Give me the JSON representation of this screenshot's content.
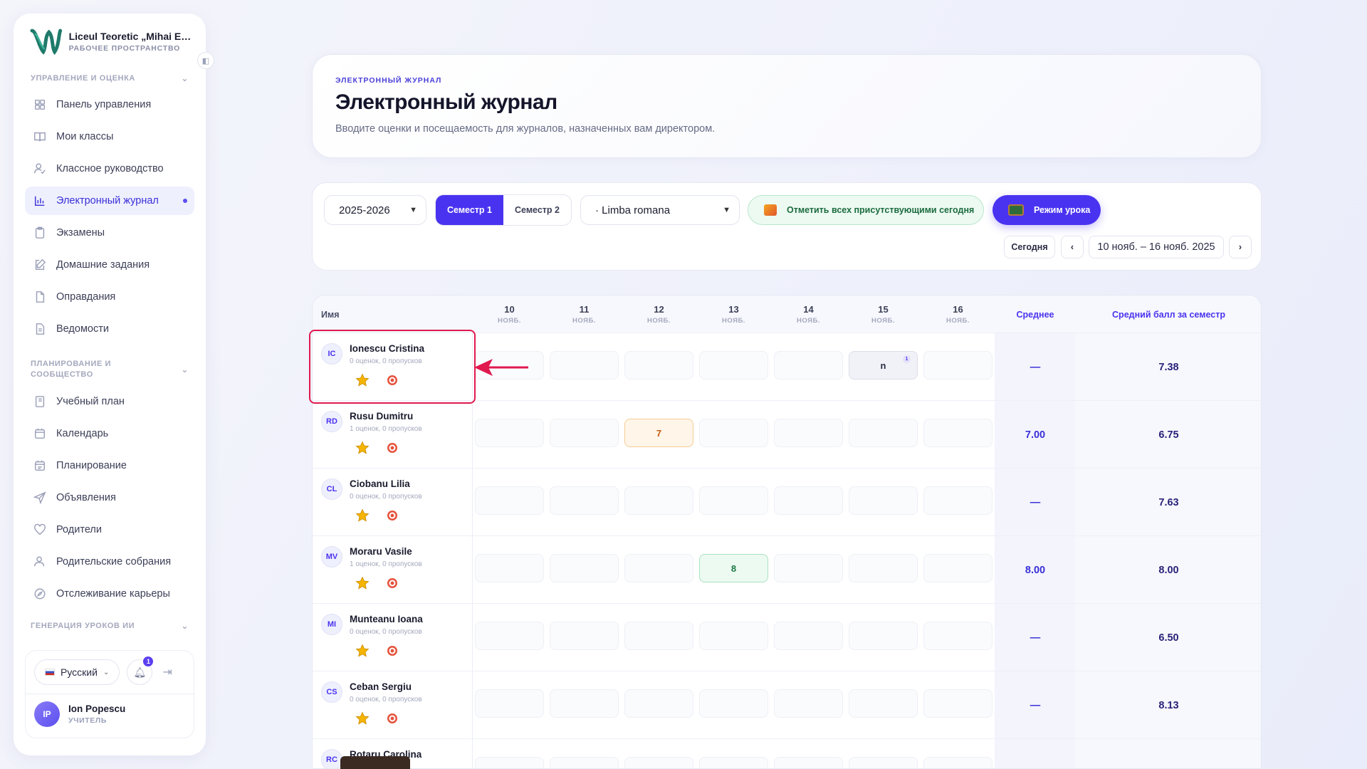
{
  "sidebar": {
    "school_name": "Liceul Teoretic „Mihai Emi...",
    "workspace_label": "РАБОЧЕЕ ПРОСТРАНСТВО",
    "sections": [
      {
        "title": "УПРАВЛЕНИЕ И ОЦЕНКА",
        "items": [
          {
            "label": "Панель управления",
            "icon": "dashboard-icon"
          },
          {
            "label": "Мои классы",
            "icon": "book-icon"
          },
          {
            "label": "Классное руководство",
            "icon": "user-check-icon"
          },
          {
            "label": "Электронный журнал",
            "icon": "bar-chart-icon",
            "active": true
          },
          {
            "label": "Экзамены",
            "icon": "clipboard-icon"
          },
          {
            "label": "Домашние задания",
            "icon": "edit-icon"
          },
          {
            "label": "Оправдания",
            "icon": "file-icon"
          },
          {
            "label": "Ведомости",
            "icon": "file-text-icon"
          }
        ]
      },
      {
        "title": "ПЛАНИРОВАНИЕ И СООБЩЕСТВО",
        "items": [
          {
            "label": "Учебный план",
            "icon": "notebook-icon"
          },
          {
            "label": "Календарь",
            "icon": "calendar-icon"
          },
          {
            "label": "Планирование",
            "icon": "calendar-check-icon"
          },
          {
            "label": "Объявления",
            "icon": "send-icon"
          },
          {
            "label": "Родители",
            "icon": "heart-icon"
          },
          {
            "label": "Родительские собрания",
            "icon": "users-icon"
          },
          {
            "label": "Отслеживание карьеры",
            "icon": "compass-icon"
          }
        ]
      },
      {
        "title": "ГЕНЕРАЦИЯ УРОКОВ ИИ",
        "items": []
      }
    ],
    "footer": {
      "language": "Русский",
      "notifications_count": "1",
      "user_initials": "IP",
      "user_name": "Ion Popescu",
      "user_role": "УЧИТЕЛЬ"
    }
  },
  "header": {
    "eyebrow": "ЭЛЕКТРОННЫЙ ЖУРНАЛ",
    "title": "Электронный журнал",
    "subtitle": "Вводите оценки и посещаемость для журналов, назначенных вам директором."
  },
  "filters": {
    "year": "2025-2026",
    "semesters": [
      "Семестр 1",
      "Семестр 2"
    ],
    "active_semester": "Семестр 1",
    "subject": "· Limba romana",
    "mark_all_label": "Отметить всех присутствующими сегодня",
    "lesson_mode_label": "Режим урока",
    "today_label": "Сегодня",
    "date_range": "10 нояб. – 16 нояб. 2025"
  },
  "table": {
    "name_header": "Имя",
    "days": [
      {
        "day": "10",
        "month": "НОЯБ."
      },
      {
        "day": "11",
        "month": "НОЯБ."
      },
      {
        "day": "12",
        "month": "НОЯБ."
      },
      {
        "day": "13",
        "month": "НОЯБ."
      },
      {
        "day": "14",
        "month": "НОЯБ."
      },
      {
        "day": "15",
        "month": "НОЯБ."
      },
      {
        "day": "16",
        "month": "НОЯБ."
      }
    ],
    "avg_header": "Среднее",
    "semester_avg_header": "Средний балл за семестр",
    "rows": [
      {
        "initials": "IC",
        "name": "Ionescu Cristina",
        "stats": "0 оценок, 0 пропусков",
        "cells": [
          "",
          "",
          "",
          "",
          "",
          "n",
          ""
        ],
        "cell_badge": "1",
        "avg": "—",
        "semester_avg": "7.38"
      },
      {
        "initials": "RD",
        "name": "Rusu Dumitru",
        "stats": "1 оценок, 0 пропусков",
        "cells": [
          "",
          "",
          "7",
          "",
          "",
          "",
          ""
        ],
        "avg": "7.00",
        "semester_avg": "6.75"
      },
      {
        "initials": "CL",
        "name": "Ciobanu Lilia",
        "stats": "0 оценок, 0 пропусков",
        "cells": [
          "",
          "",
          "",
          "",
          "",
          "",
          ""
        ],
        "avg": "—",
        "semester_avg": "7.63"
      },
      {
        "initials": "MV",
        "name": "Moraru Vasile",
        "stats": "1 оценок, 0 пропусков",
        "cells": [
          "",
          "",
          "",
          "8",
          "",
          "",
          ""
        ],
        "avg": "8.00",
        "semester_avg": "8.00"
      },
      {
        "initials": "MI",
        "name": "Munteanu Ioana",
        "stats": "0 оценок, 0 пропусков",
        "cells": [
          "",
          "",
          "",
          "",
          "",
          "",
          ""
        ],
        "avg": "—",
        "semester_avg": "6.50"
      },
      {
        "initials": "CS",
        "name": "Ceban Sergiu",
        "stats": "0 оценок, 0 пропусков",
        "cells": [
          "",
          "",
          "",
          "",
          "",
          "",
          ""
        ],
        "avg": "—",
        "semester_avg": "8.13"
      },
      {
        "initials": "RC",
        "name": "Rotaru Carolina",
        "stats": "",
        "cells": [
          "",
          "",
          "",
          "",
          "",
          "",
          ""
        ],
        "avg": "",
        "semester_avg": ""
      }
    ]
  },
  "colors": {
    "accent": "#4a33f0",
    "grade_orange": "#c25a10",
    "grade_green": "#1f7a47",
    "highlight": "#e0194f"
  }
}
